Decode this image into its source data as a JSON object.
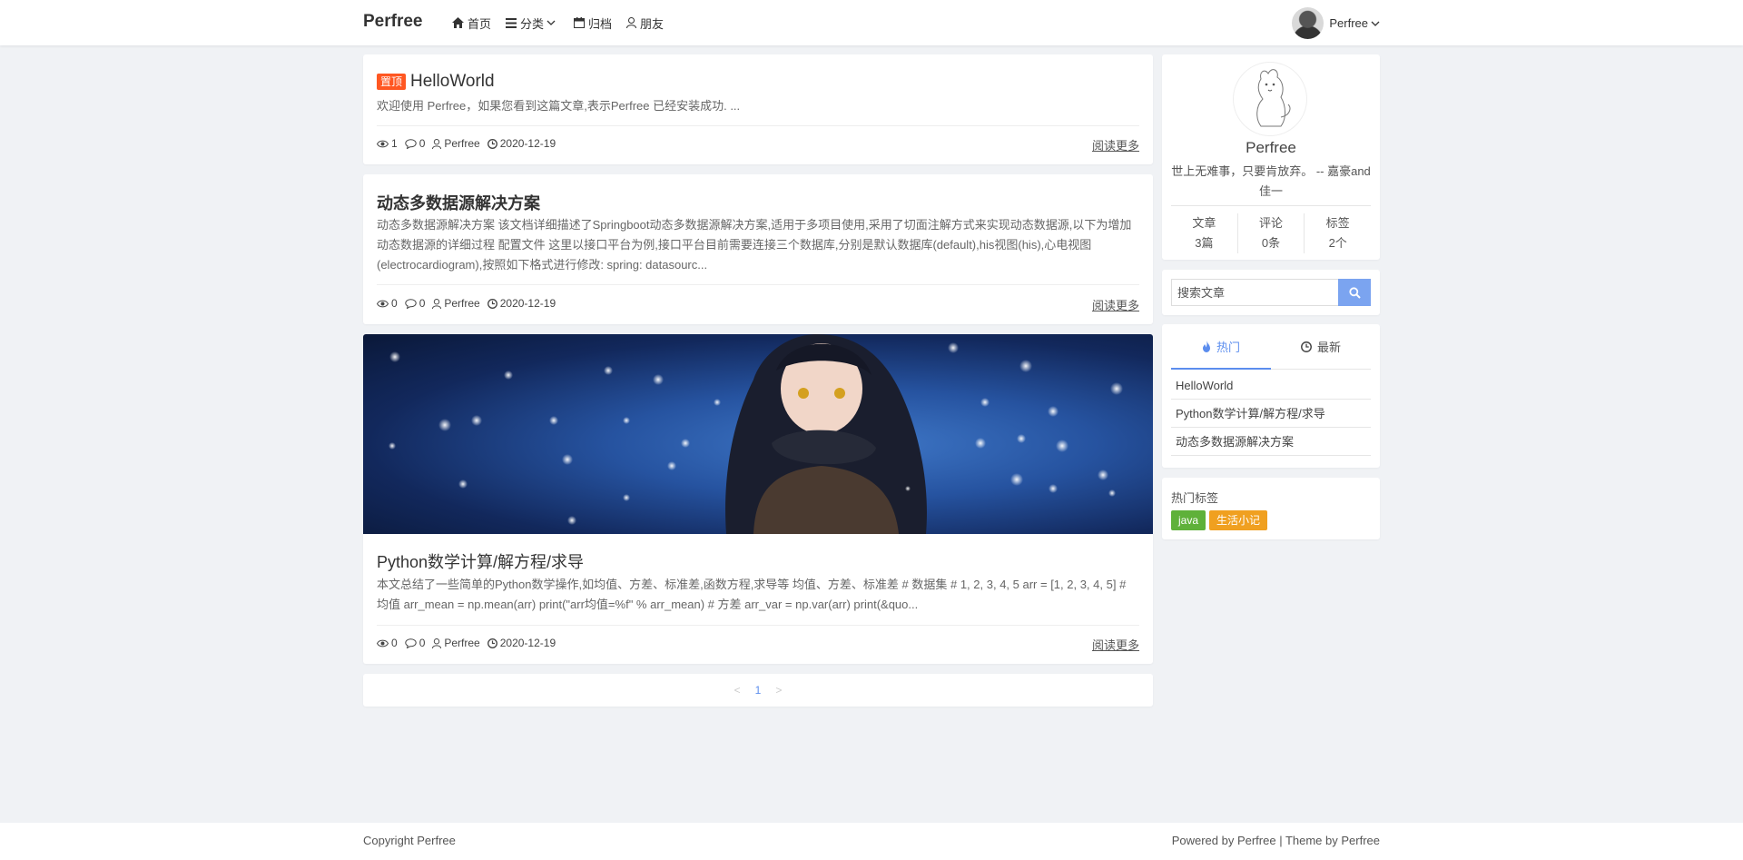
{
  "header": {
    "logo": "Perfree",
    "nav": [
      {
        "label": "首页",
        "icon": "home-icon"
      },
      {
        "label": "分类",
        "icon": "list-icon"
      },
      {
        "label": "归档",
        "icon": "calendar-icon"
      },
      {
        "label": "朋友",
        "icon": "user-icon"
      }
    ],
    "user_name": "Perfree"
  },
  "posts": [
    {
      "badge": "置顶",
      "title": "HelloWorld",
      "excerpt": "欢迎使用 Perfree，如果您看到这篇文章,表示Perfree 已经安装成功. ...",
      "views": "1",
      "comments": "0",
      "author": "Perfree",
      "date": "2020-12-19",
      "read_more": "阅读更多"
    },
    {
      "title": "动态多数据源解决方案",
      "excerpt": "动态多数据源解决方案 该文档详细描述了Springboot动态多数据源解决方案,适用于多项目使用,采用了切面注解方式来实现动态数据源,以下为增加动态数据源的详细过程 配置文件 这里以接口平台为例,接口平台目前需要连接三个数据库,分别是默认数据库(default),his视图(his),心电视图(electrocardiogram),按照如下格式进行修改: spring: datasourc...",
      "views": "0",
      "comments": "0",
      "author": "Perfree",
      "date": "2020-12-19",
      "read_more": "阅读更多"
    },
    {
      "title": "Python数学计算/解方程/求导",
      "excerpt": "本文总结了一些简单的Python数学操作,如均值、方差、标准差,函数方程,求导等 均值、方差、标准差 # 数据集 # 1, 2, 3, 4, 5 arr = [1, 2, 3, 4, 5] # 均值 arr_mean = np.mean(arr) print(\"arr均值=%f\" % arr_mean) # 方差 arr_var = np.var(arr) print(&quo...",
      "views": "0",
      "comments": "0",
      "author": "Perfree",
      "date": "2020-12-19",
      "read_more": "阅读更多"
    }
  ],
  "pagination": {
    "prev": "<",
    "current": "1",
    "next": ">"
  },
  "profile": {
    "name": "Perfree",
    "motto": "世上无难事，只要肯放弃。 -- 嘉豪and佳一",
    "stats": [
      {
        "label": "文章",
        "value": "3篇"
      },
      {
        "label": "评论",
        "value": "0条"
      },
      {
        "label": "标签",
        "value": "2个"
      }
    ]
  },
  "search": {
    "placeholder": "搜索文章"
  },
  "tabs": {
    "hot": "热门",
    "latest": "最新"
  },
  "hot_list": [
    "HelloWorld",
    "Python数学计算/解方程/求导",
    "动态多数据源解决方案"
  ],
  "tags_section": {
    "title": "热门标签",
    "tags": [
      {
        "label": "java",
        "color": "#5fb13a"
      },
      {
        "label": "生活小记",
        "color": "#f0a020"
      }
    ]
  },
  "footer": {
    "left": "Copyright Perfree",
    "right": "Powered by Perfree | Theme by Perfree"
  },
  "colors": {
    "accent": "#5b8dee",
    "badge": "#ff5722"
  }
}
